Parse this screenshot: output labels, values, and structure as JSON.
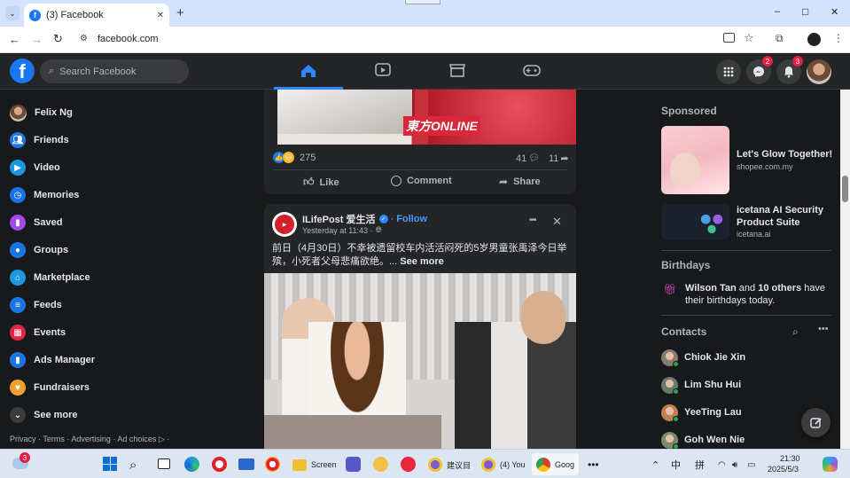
{
  "browser": {
    "tab_title": "(3) Facebook",
    "url": "facebook.com",
    "new_tab": "+",
    "win_min": "–",
    "win_max": "□",
    "win_close": "✕"
  },
  "fb": {
    "logo": "f",
    "search_placeholder": "Search Facebook",
    "messenger_badge": "2",
    "notif_badge": "3"
  },
  "left_menu": [
    {
      "label": "Felix Ng",
      "icon": "profile-avatar",
      "color": "#a0786a"
    },
    {
      "label": "Friends",
      "icon": "friends-icon",
      "color": "#1b74e4"
    },
    {
      "label": "Video",
      "icon": "video-icon",
      "color": "#1b98e4"
    },
    {
      "label": "Memories",
      "icon": "memories-icon",
      "color": "#1b74e4"
    },
    {
      "label": "Saved",
      "icon": "saved-icon",
      "color": "#a347e8"
    },
    {
      "label": "Groups",
      "icon": "groups-icon",
      "color": "#1b74e4"
    },
    {
      "label": "Marketplace",
      "icon": "marketplace-icon",
      "color": "#1b98e4"
    },
    {
      "label": "Feeds",
      "icon": "feeds-icon",
      "color": "#1b74e4"
    },
    {
      "label": "Events",
      "icon": "events-icon",
      "color": "#e42645"
    },
    {
      "label": "Ads Manager",
      "icon": "ads-manager-icon",
      "color": "#1b74e4"
    },
    {
      "label": "Fundraisers",
      "icon": "fundraisers-icon",
      "color": "#f0a030"
    },
    {
      "label": "See more",
      "icon": "chevron-down-icon",
      "color": "#3a3b3c"
    }
  ],
  "footer_links": "Privacy · Terms · Advertising · Ad choices ▷ ·",
  "post1": {
    "image_text": "東方ONLINE",
    "reaction_count": "275",
    "comment_count": "41",
    "share_count": "11",
    "like_label": "Like",
    "comment_label": "Comment",
    "share_label": "Share"
  },
  "post2": {
    "page_name": "ILifePost 爱生活",
    "follow_label": "Follow",
    "time": "Yesterday at 11:43 ·",
    "text": "前日（4月30日）不幸被遗留校车内活活闷死的5岁男童张禹泽今日举殡，小死者父母悲痛欲绝。...",
    "see_more": "See more",
    "more_icon": "•••",
    "close_icon": "✕"
  },
  "sponsored": {
    "title": "Sponsored",
    "ads": [
      {
        "headline": "Let's Glow Together!",
        "domain": "shopee.com.my"
      },
      {
        "headline": "icetana AI Security Product Suite",
        "domain": "icetana.ai"
      }
    ]
  },
  "birthdays": {
    "title": "Birthdays",
    "text_bold": "Wilson Tan",
    "text_mid": " and ",
    "text_bold2": "10 others",
    "text_end": " have their birthdays today."
  },
  "contacts": {
    "title": "Contacts",
    "list": [
      {
        "name": "Chiok Jie Xin",
        "color": "#8a7a70"
      },
      {
        "name": "Lim Shu Hui",
        "color": "#6a7a6a"
      },
      {
        "name": "YeeTing Lau",
        "color": "#c08050"
      },
      {
        "name": "Goh Wen Nie",
        "color": "#7a8a6a"
      }
    ]
  },
  "taskbar": {
    "weather_badge": "3",
    "app1": "Screen",
    "app2": "建议目",
    "app3": "(4) You",
    "app4": "Goog",
    "lang1": "中",
    "lang2": "拼",
    "time": "21:30",
    "date": "2025/5/3"
  }
}
